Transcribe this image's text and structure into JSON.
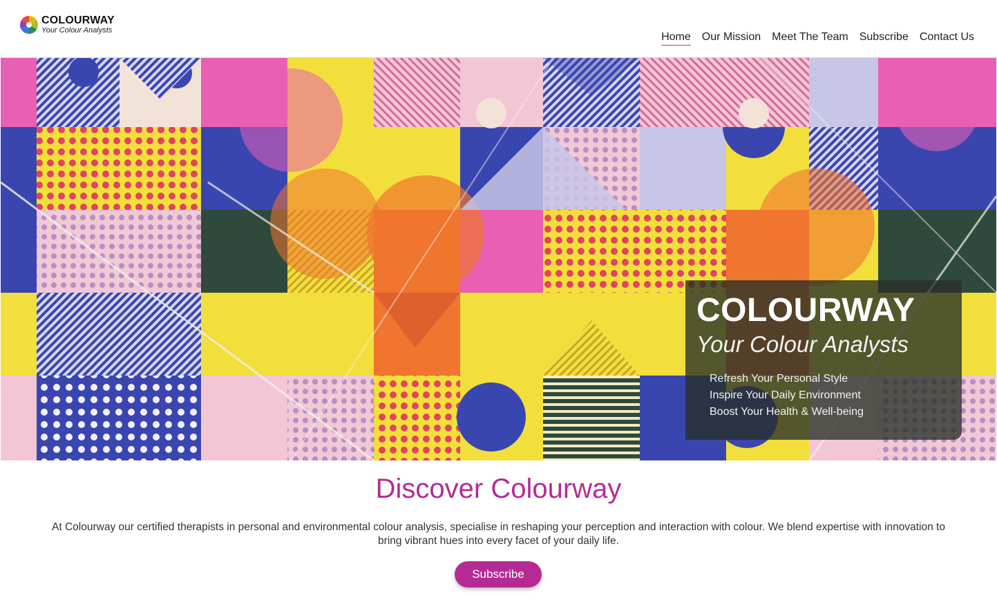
{
  "brand": {
    "name": "COLOURWAY",
    "tagline": "Your Colour Analysts"
  },
  "nav": {
    "items": [
      {
        "label": "Home",
        "active": true
      },
      {
        "label": "Our Mission",
        "active": false
      },
      {
        "label": "Meet The Team",
        "active": false
      },
      {
        "label": "Subscribe",
        "active": false
      },
      {
        "label": "Contact Us",
        "active": false
      }
    ]
  },
  "hero": {
    "title": "COLOURWAY",
    "subtitle": "Your Colour Analysts",
    "bullets": [
      "Refresh Your Personal Style",
      "Inspire Your Daily Environment",
      "Boost Your Health & Well-being"
    ]
  },
  "main": {
    "heading": "Discover Colourway",
    "intro": "At Colourway our certified therapists in personal and environmental colour analysis, specialise in reshaping your perception and interaction with colour. We blend expertise with innovation to bring vibrant hues into every facet of your daily life.",
    "cta_label": "Subscribe"
  },
  "colors": {
    "accent": "#b42b96",
    "nav_underline": "#c8287e",
    "pattern_blue": "#3a46b0",
    "pattern_pink": "#e85fb4",
    "pattern_yellow": "#f2df3c",
    "pattern_orange": "#f0752e",
    "pattern_dark": "#2f4a3c"
  }
}
